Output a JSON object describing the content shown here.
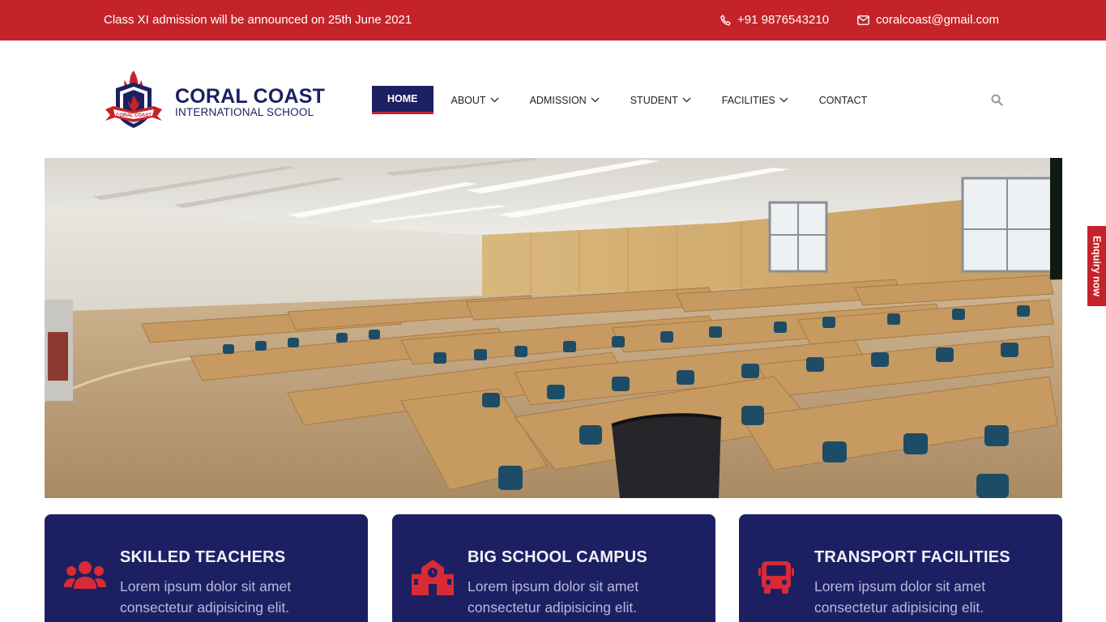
{
  "topbar": {
    "announcement": "Class XI admission will be announced on 25th June 2021",
    "phone": "+91 9876543210",
    "email": "coralcoast@gmail.com"
  },
  "brand": {
    "title": "CORAL COAST",
    "subtitle": "INTERNATIONAL SCHOOL",
    "badge_text": "CORAL COAST"
  },
  "nav": {
    "items": [
      {
        "label": "HOME",
        "active": true
      },
      {
        "label": "ABOUT",
        "dropdown": true
      },
      {
        "label": "ADMISSION",
        "dropdown": true
      },
      {
        "label": "STUDENT",
        "dropdown": true
      },
      {
        "label": "FACILITIES",
        "dropdown": true
      },
      {
        "label": "CONTACT"
      }
    ],
    "search_icon": "search-icon"
  },
  "enquiry": {
    "label": "Enquiry now"
  },
  "features": [
    {
      "icon": "users-icon",
      "title": "SKILLED TEACHERS",
      "text": "Lorem ipsum dolor sit amet consectetur adipisicing elit."
    },
    {
      "icon": "school-icon",
      "title": "BIG SCHOOL CAMPUS",
      "text": "Lorem ipsum dolor sit amet consectetur adipisicing elit."
    },
    {
      "icon": "bus-icon",
      "title": "TRANSPORT FACILITIES",
      "text": "Lorem ipsum dolor sit amet consectetur adipisicing elit."
    }
  ],
  "colors": {
    "brand_red": "#c4232a",
    "brand_navy": "#1c2063"
  }
}
